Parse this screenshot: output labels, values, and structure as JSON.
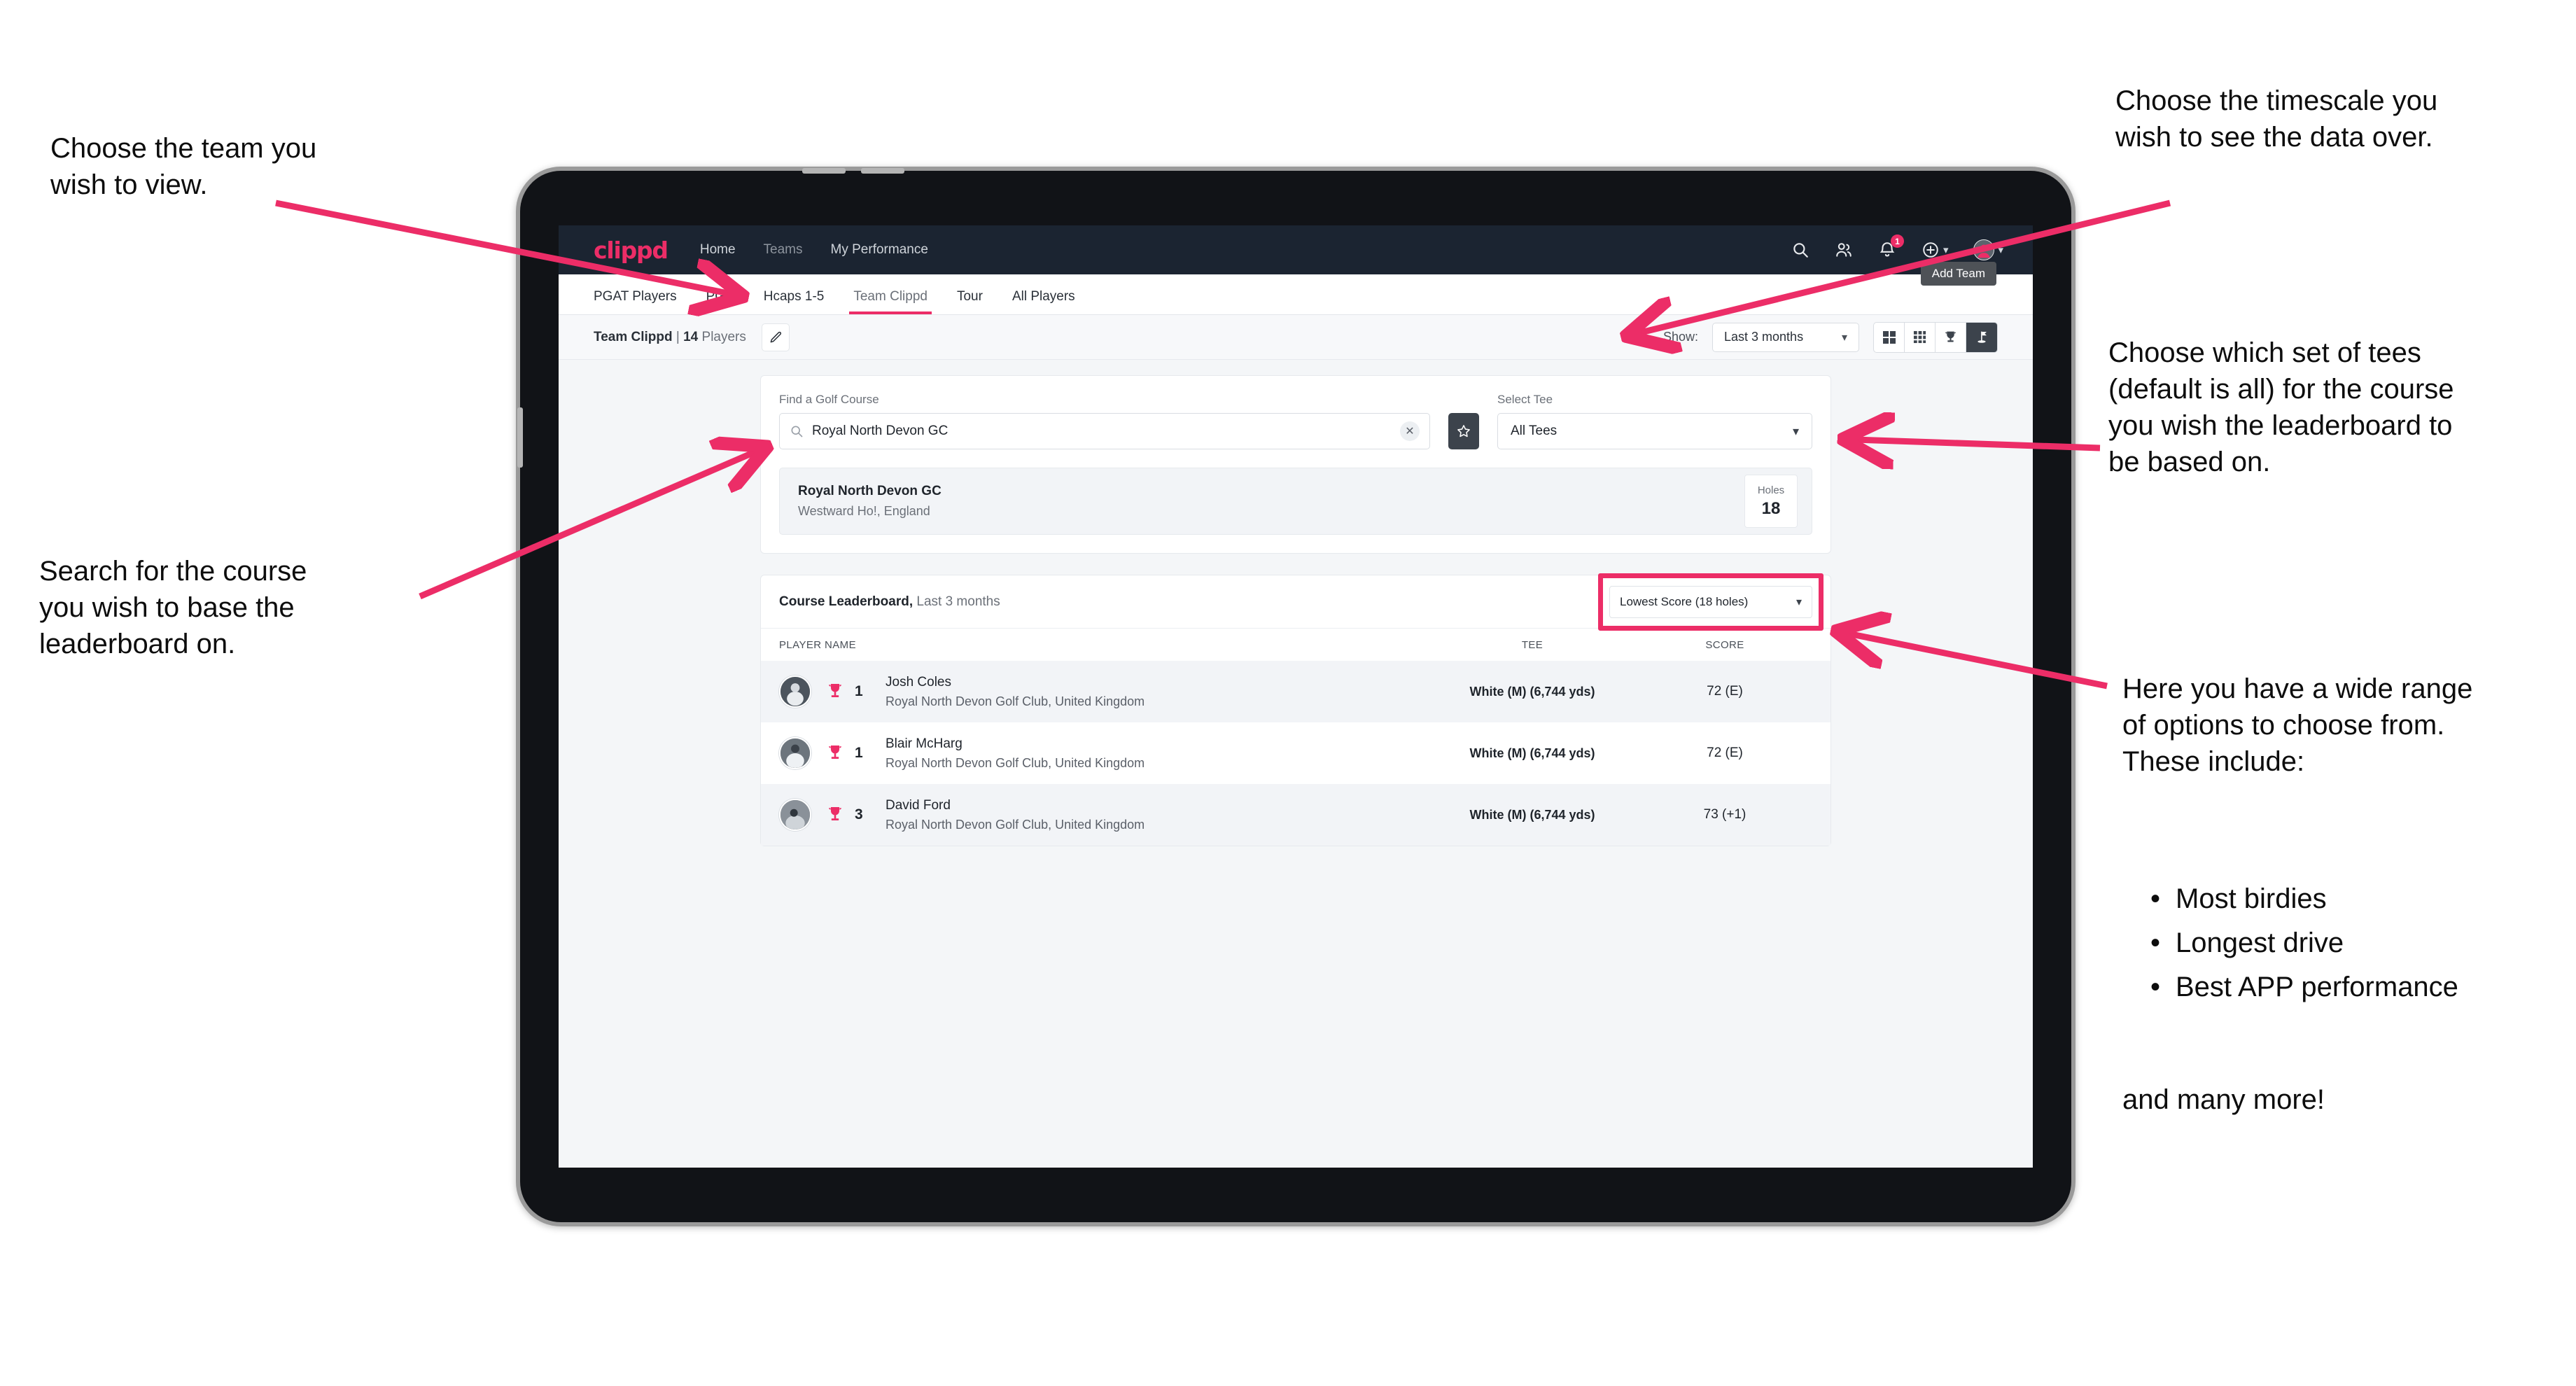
{
  "annotations": {
    "team": "Choose the team you\nwish to view.",
    "search": "Search for the course\nyou wish to base the\nleaderboard on.",
    "timescale": "Choose the timescale you\nwish to see the data over.",
    "tees": "Choose which set of tees\n(default is all) for the course\nyou wish the leaderboard to\nbe based on.",
    "options_intro": "Here you have a wide range\nof options to choose from.\nThese include:",
    "options_list": [
      "Most birdies",
      "Longest drive",
      "Best APP performance"
    ],
    "options_outro": "and many more!",
    "accent": "#ec2d67"
  },
  "app": {
    "brand": "clippd",
    "nav": [
      {
        "label": "Home",
        "active": true
      },
      {
        "label": "Teams",
        "active": false
      },
      {
        "label": "My Performance",
        "active": true
      }
    ],
    "icons": {
      "search": "search-icon",
      "people": "people-icon",
      "bell": "bell-icon",
      "plus": "plus-circle-icon",
      "avatar": "user-avatar"
    },
    "notification_count": "1",
    "tooltip": "Add Team"
  },
  "tabs": [
    {
      "label": "PGAT Players",
      "state": "normal"
    },
    {
      "label": "PGA",
      "state": "normal"
    },
    {
      "label": "Hcaps 1-5",
      "state": "normal"
    },
    {
      "label": "Team Clippd",
      "state": "active"
    },
    {
      "label": "Tour",
      "state": "normal"
    },
    {
      "label": "All Players",
      "state": "normal"
    }
  ],
  "subbar": {
    "team_name": "Team Clippd",
    "separator": "|",
    "player_count": "14",
    "players_word": "Players",
    "edit_icon": "pencil-icon",
    "show_label": "Show:",
    "timescale_value": "Last 3 months",
    "view_modes": [
      {
        "icon": "grid-2x2-icon",
        "active": false
      },
      {
        "icon": "grid-3x3-icon",
        "active": false
      },
      {
        "icon": "trophy-icon",
        "active": false
      },
      {
        "icon": "golf-flag-icon",
        "active": true
      }
    ]
  },
  "search_panel": {
    "course_label": "Find a Golf Course",
    "course_value": "Royal North Devon GC",
    "course_placeholder": "Find a Golf Course",
    "search_icon": "search-icon",
    "clear_icon": "close-icon",
    "favourite_icon": "star-icon",
    "tee_label": "Select Tee",
    "tee_value": "All Tees"
  },
  "course_result": {
    "name": "Royal North Devon GC",
    "location": "Westward Ho!, England",
    "holes_label": "Holes",
    "holes_value": "18"
  },
  "leaderboard": {
    "title": "Course Leaderboard,",
    "subtitle": "Last 3 months",
    "sort_value": "Lowest Score (18 holes)",
    "columns": [
      "PLAYER NAME",
      "TEE",
      "SCORE"
    ],
    "rows": [
      {
        "rank": "1",
        "name": "Josh Coles",
        "club": "Royal North Devon Golf Club, United Kingdom",
        "tee": "White (M) (6,744 yds)",
        "score": "72 (E)"
      },
      {
        "rank": "1",
        "name": "Blair McHarg",
        "club": "Royal North Devon Golf Club, United Kingdom",
        "tee": "White (M) (6,744 yds)",
        "score": "72 (E)"
      },
      {
        "rank": "3",
        "name": "David Ford",
        "club": "Royal North Devon Golf Club, United Kingdom",
        "tee": "White (M) (6,744 yds)",
        "score": "73 (+1)"
      }
    ]
  }
}
